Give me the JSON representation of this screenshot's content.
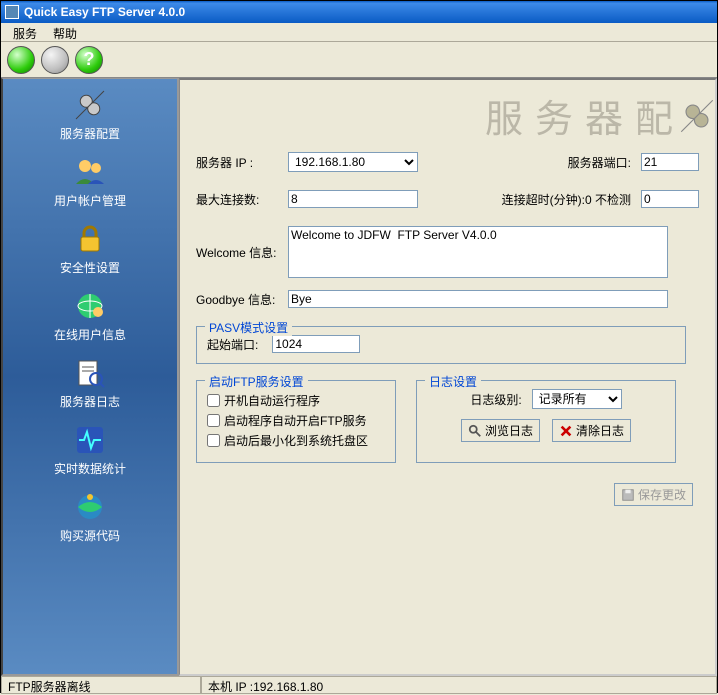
{
  "window": {
    "title": "Quick Easy FTP Server 4.0.0"
  },
  "menu": {
    "service": "服务",
    "help": "帮助"
  },
  "sidebar": {
    "items": [
      {
        "label": "服务器配置"
      },
      {
        "label": "用户帐户管理"
      },
      {
        "label": "安全性设置"
      },
      {
        "label": "在线用户信息"
      },
      {
        "label": "服务器日志"
      },
      {
        "label": "实时数据统计"
      },
      {
        "label": "购买源代码"
      }
    ]
  },
  "banner": "服务器配",
  "form": {
    "server_ip_label": "服务器 IP :",
    "server_ip": "192.168.1.80",
    "server_port_label": "服务器端口:",
    "server_port": "21",
    "max_conn_label": "最大连接数:",
    "max_conn": "8",
    "timeout_label": "连接超时(分钟):0 不检测",
    "timeout": "0",
    "welcome_label": "Welcome 信息:",
    "welcome": "Welcome to JDFW  FTP Server V4.0.0",
    "goodbye_label": "Goodbye 信息:",
    "goodbye": "Bye"
  },
  "pasv": {
    "legend": "PASV模式设置",
    "start_port_label": "起始端口:",
    "start_port": "1024"
  },
  "ftp_start": {
    "legend": "启动FTP服务设置",
    "chk1": "开机自动运行程序",
    "chk2": "启动程序自动开启FTP服务",
    "chk3": "启动后最小化到系统托盘区"
  },
  "log": {
    "legend": "日志设置",
    "level_label": "日志级别:",
    "level_value": "记录所有",
    "browse": "浏览日志",
    "clear": "清除日志"
  },
  "save_btn": "保存更改",
  "status": {
    "left": "FTP服务器离线",
    "right": "本机 IP :192.168.1.80"
  }
}
